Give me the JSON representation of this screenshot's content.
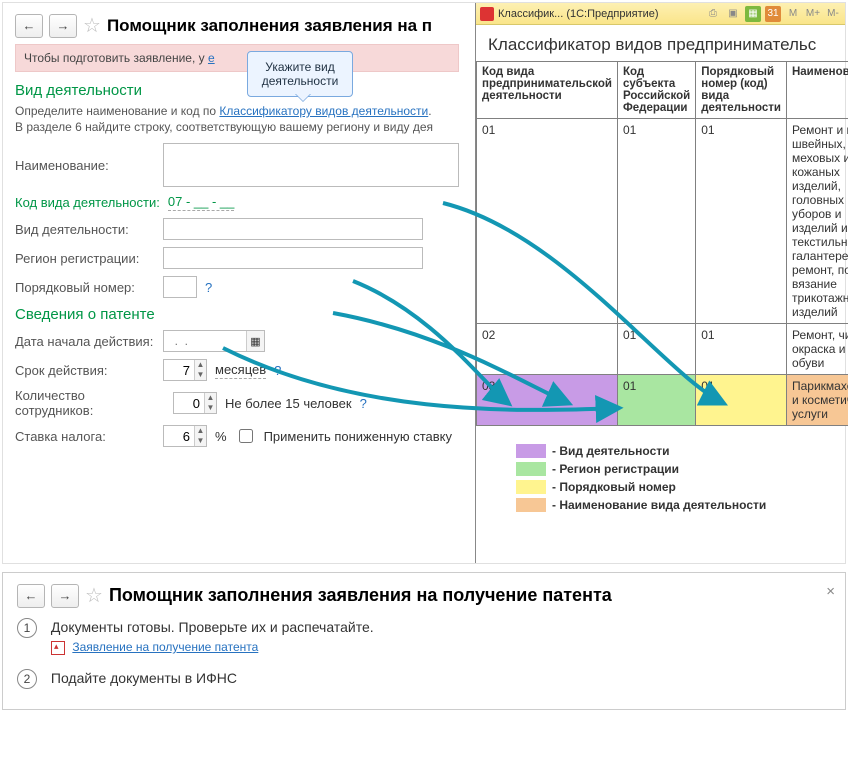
{
  "main": {
    "title": "Помощник заполнения заявления на п",
    "warn_prefix": "Чтобы подготовить заявление, у",
    "warn_link": "е",
    "balloon": "Укажите вид деятельности",
    "sect_activity": "Вид деятельности",
    "hint_line1_a": "Определите наименование и код по ",
    "hint_line1_link": "Классификатору видов деятельности",
    "hint_line1_b": ".",
    "hint_line2": "В разделе 6 найдите строку, соответствующую вашему региону и виду дея",
    "lbl_name": "Наименование:",
    "lbl_code": "Код вида деятельности:",
    "code_value": "07 - __ - __",
    "lbl_activity": "Вид деятельности:",
    "lbl_region": "Регион регистрации:",
    "lbl_serial": "Порядковый номер:",
    "sect_patent": "Сведения о патенте",
    "lbl_start": "Дата начала действия:",
    "date_placeholder": "  .  .    ",
    "lbl_term": "Срок действия:",
    "term_value": "7",
    "term_unit": "месяцев",
    "lbl_emp": "Количество сотрудников:",
    "emp_value": "0",
    "emp_note": "Не более 15 человек",
    "lbl_rate": "Ставка налога:",
    "rate_value": "6",
    "pct": "%",
    "chk_reduced": "Применить пониженную ставку"
  },
  "popup": {
    "win_title": "Классифик... (1С:Предприятие)",
    "heading": "Классификатор видов предпринимательс",
    "th1": "Код вида предпринимательской деятельности",
    "th2": "Код субъекта Российской Федерации",
    "th3": "Порядковый номер (код) вида деятельности",
    "th4": "Наименование",
    "rows": [
      {
        "c1": "01",
        "c2": "01",
        "c3": "01",
        "name": "Ремонт и пошив швейных, меховых и кожаных изделий, головных уборов и изделий из текстильной галантереи, ремонт, пошив и вязание трикотажных изделий"
      },
      {
        "c1": "02",
        "c2": "01",
        "c3": "01",
        "name": "Ремонт, чистка, окраска и пошив обуви"
      },
      {
        "c1": "03",
        "c2": "01",
        "c3": "01",
        "name": "Парикмахерские и косметические услуги"
      }
    ],
    "legend": {
      "purple": "- Вид деятельности",
      "green": "- Регион регистрации",
      "yellow": "- Порядковый номер",
      "orange": "- Наименование вида деятельности"
    }
  },
  "bottom": {
    "title": "Помощник заполнения заявления на получение патента",
    "step1": "Документы готовы. Проверьте их и распечатайте.",
    "doc_link": "Заявление на получение патента",
    "step2": "Подайте документы в ИФНС"
  }
}
